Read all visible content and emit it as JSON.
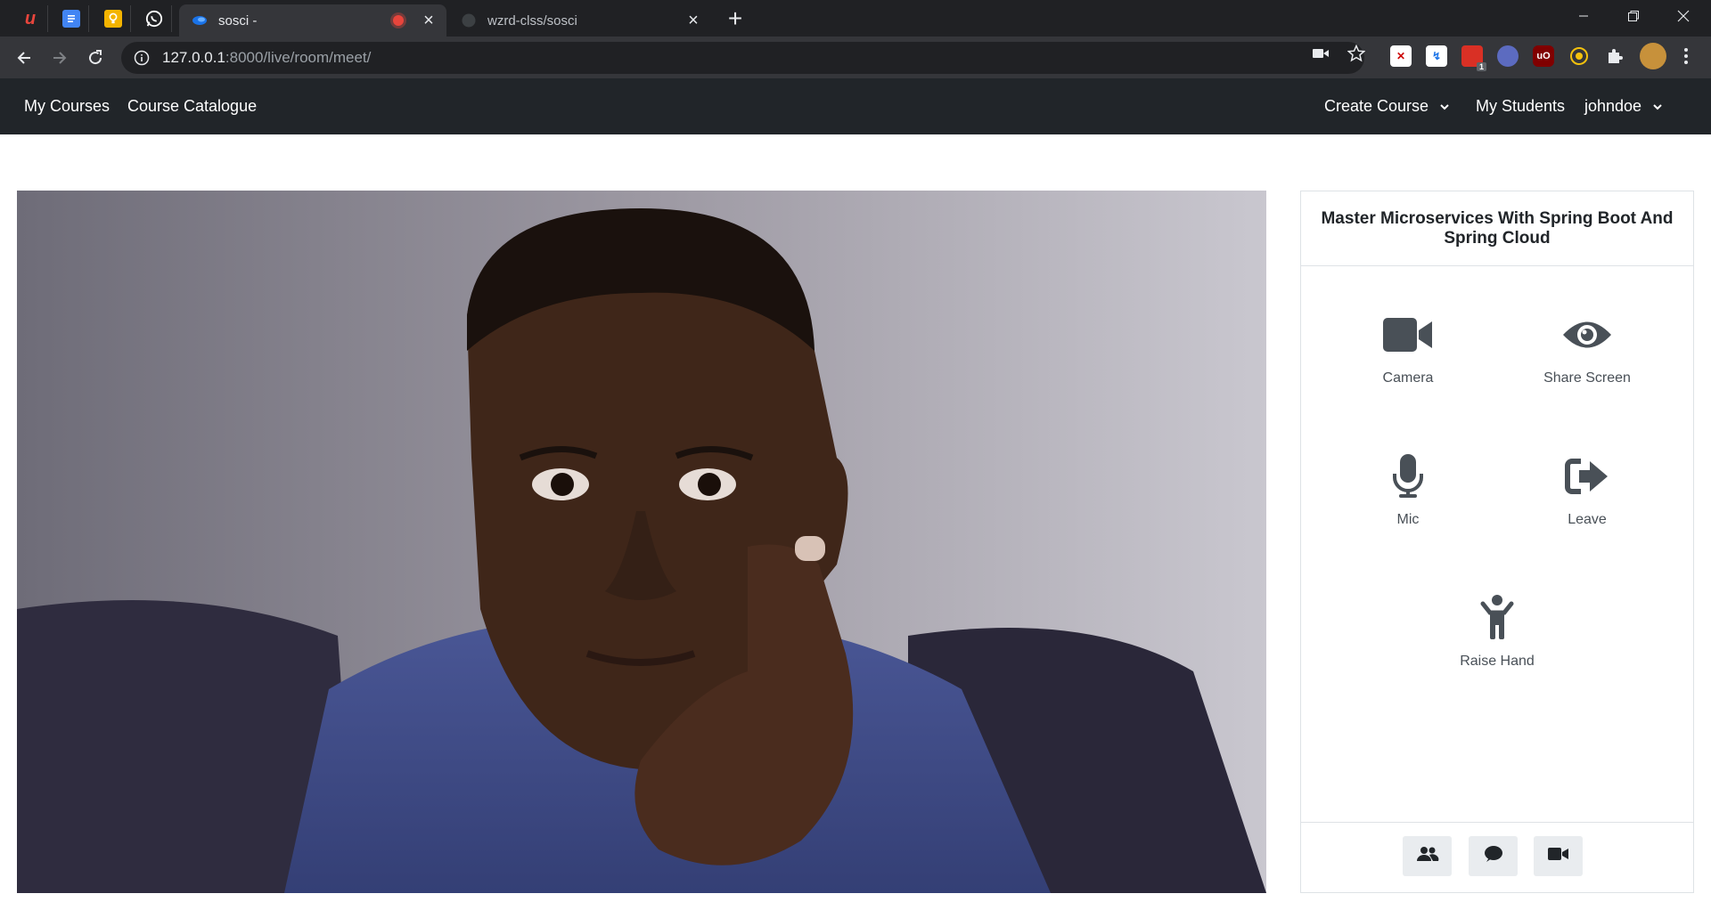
{
  "browser": {
    "pinned_tabs": [
      {
        "icon": "u-logo-icon",
        "glyph": "u",
        "color": "#e8453c"
      },
      {
        "icon": "google-docs-icon",
        "glyph": "≡",
        "color": "#4285f4"
      },
      {
        "icon": "google-keep-icon",
        "glyph": "💡",
        "color": "#f4b400"
      },
      {
        "icon": "whatsapp-icon",
        "glyph": "✆",
        "color": "#25d366"
      }
    ],
    "tabs": [
      {
        "title": "sosci -",
        "active": true,
        "recording": true
      },
      {
        "title": "wzrd-clss/sosci",
        "active": false,
        "recording": false
      }
    ],
    "url_host": "127.0.0.1",
    "url_rest": ":8000/live/room/meet/",
    "extension_badge": "1"
  },
  "navbar": {
    "left_links": [
      "My Courses",
      "Course Catalogue"
    ],
    "create_course": "Create Course",
    "my_students": "My Students",
    "user": "johndoe"
  },
  "panel": {
    "title": "Master Microservices With Spring Boot And Spring Cloud",
    "controls": {
      "camera": "Camera",
      "share_screen": "Share Screen",
      "mic": "Mic",
      "leave": "Leave",
      "raise_hand": "Raise Hand"
    },
    "footer_icons": [
      "users-icon",
      "chat-icon",
      "video-icon"
    ]
  },
  "colors": {
    "navbar_bg": "#212529",
    "icon_gray": "#495057",
    "chrome_dark": "#202124",
    "chrome_toolbar": "#35363a"
  }
}
